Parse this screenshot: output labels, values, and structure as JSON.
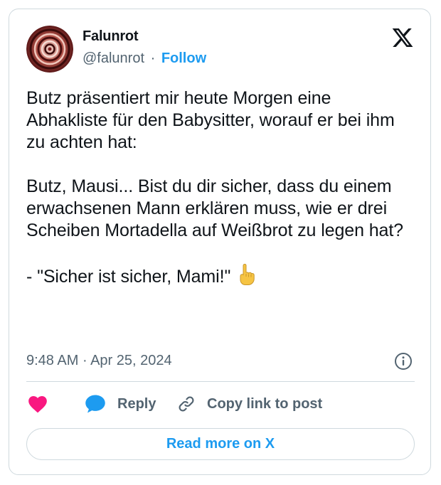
{
  "author": {
    "display_name": "Falunrot",
    "handle": "@falunrot",
    "separator": "·",
    "follow_label": "Follow",
    "avatar_icon": "spiral-avatar-icon"
  },
  "brand": {
    "logo_icon": "x-logo-icon",
    "text_color": "#0f1419",
    "secondary_color": "#536471",
    "accent_color": "#1d9bf0",
    "like_color": "#f91880",
    "border_color": "#cfd9de"
  },
  "tweet": {
    "line1": "Butz präsentiert mir heute Morgen eine Abhakliste für den Babysitter, worauf er bei ihm zu achten hat:",
    "line2": "Butz, Mausi... Bist du dir sicher, dass du einem erwachsenen Mann erklären muss, wie er drei Scheiben Mortadella auf Weißbrot zu legen hat?",
    "line3": "- \"Sicher ist sicher, Mami!\"",
    "emoji_icon": "pointing-up-emoji-icon"
  },
  "meta": {
    "time": "9:48 AM",
    "separator": "·",
    "date": "Apr 25, 2024",
    "info_icon": "info-icon"
  },
  "actions": {
    "like_icon": "heart-icon",
    "reply_icon": "speech-bubble-icon",
    "reply_label": "Reply",
    "copy_icon": "link-icon",
    "copy_label": "Copy link to post"
  },
  "footer": {
    "read_more_label": "Read more on X"
  }
}
